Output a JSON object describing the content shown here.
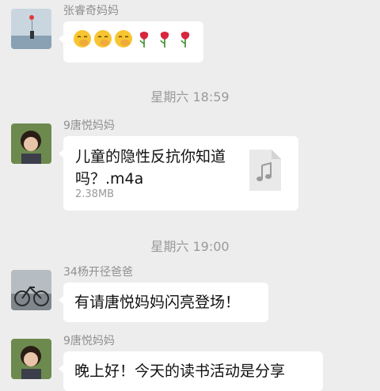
{
  "messages": [
    {
      "sender": "张睿奇妈妈",
      "type": "emoji",
      "emojis": [
        "face-with-hand-over-mouth",
        "face-with-hand-over-mouth",
        "face-with-hand-over-mouth",
        "rose",
        "rose",
        "rose"
      ]
    },
    {
      "timestamp": "星期六 18:59"
    },
    {
      "sender": "9唐悦妈妈",
      "type": "file",
      "file_name": "儿童的隐性反抗你知道吗？.m4a",
      "file_size": "2.38MB",
      "file_icon": "music-note-icon"
    },
    {
      "timestamp": "星期六 19:00"
    },
    {
      "sender": "34杨开径爸爸",
      "type": "text",
      "text": "有请唐悦妈妈闪亮登场！"
    },
    {
      "sender": "9唐悦妈妈",
      "type": "text",
      "text": "晚上好！今天的读书活动是分享"
    }
  ],
  "colors": {
    "background": "#ededed",
    "bubble": "#ffffff",
    "sender_text": "#8f8f8f",
    "timestamp_text": "#9a9a9a"
  }
}
